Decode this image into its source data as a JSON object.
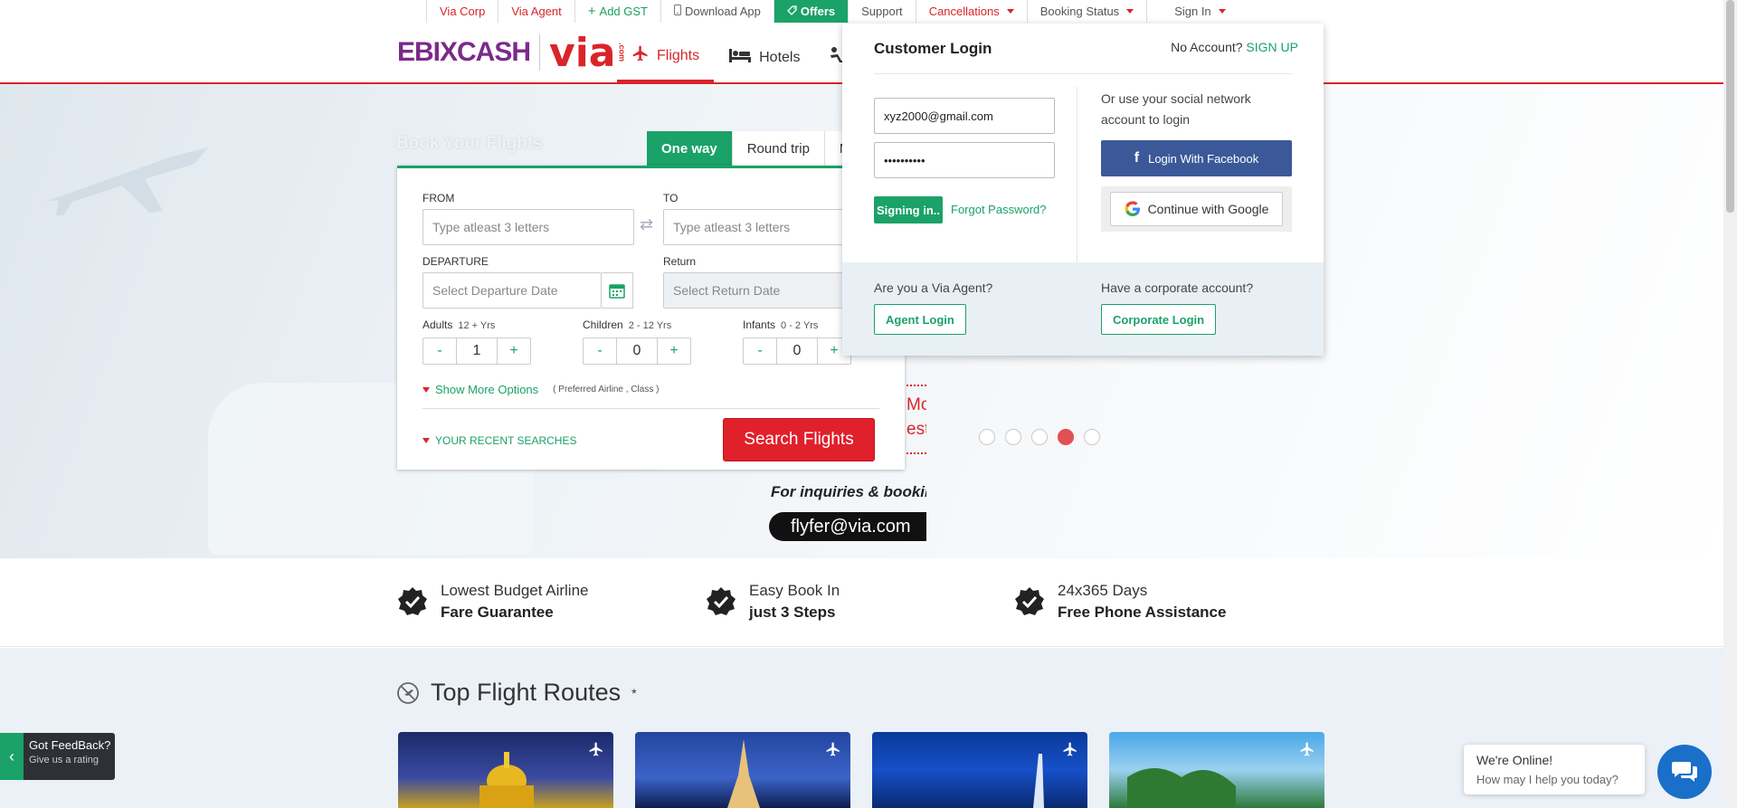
{
  "topbar": {
    "items": [
      {
        "label": "Via Corp",
        "color": "red"
      },
      {
        "label": "Via Agent",
        "color": "red"
      },
      {
        "label": "Add GST",
        "color": "green",
        "icon": "plus-icon"
      },
      {
        "label": "Download App",
        "color": "grey",
        "icon": "mobile-icon"
      },
      {
        "label": "Offers",
        "color": "offers",
        "icon": "tag-icon"
      },
      {
        "label": "Support",
        "color": "grey"
      },
      {
        "label": "Cancellations",
        "color": "red",
        "caret": true
      },
      {
        "label": "Booking Status",
        "color": "grey",
        "caret": true
      },
      {
        "label": "Sign In",
        "color": "grey",
        "caret": true
      }
    ]
  },
  "logo": {
    "ebix": "EBIXCASH",
    "via": "via",
    "com": ".com"
  },
  "nav": {
    "flights": "Flights",
    "hotels": "Hotels"
  },
  "booking": {
    "title": "Book Your Flights",
    "tabs": [
      "One way",
      "Round trip",
      "M"
    ],
    "from_label": "FROM",
    "from_placeholder": "Type atleast 3 letters",
    "to_label": "TO",
    "to_placeholder": "Type atleast 3 letters",
    "departure_label": "DEPARTURE",
    "departure_placeholder": "Select Departure Date",
    "return_label": "Return",
    "return_placeholder": "Select Return Date",
    "adults_label": "Adults",
    "adults_range": "12 + Yrs",
    "adults_value": "1",
    "children_label": "Children",
    "children_range": "2 - 12 Yrs",
    "children_value": "0",
    "infants_label": "Infants",
    "infants_range": "0 - 2 Yrs",
    "infants_value": "0",
    "minus": "-",
    "plus": "+",
    "more_options": "Show More Options",
    "more_options_hint": "( Preferred Airline , Class )",
    "recent": "YOUR RECENT SEARCHES",
    "search_button": "Search Flights"
  },
  "promo": {
    "frag1": "Mo",
    "frag2": "esti",
    "inquiries": "For inquiries & bookin",
    "email": "flyfer@via.com",
    "slide_dots": 5,
    "active_dot": 4
  },
  "features": [
    {
      "line1": "Lowest Budget Airline",
      "line2": "Fare Guarantee"
    },
    {
      "line1": "Easy Book In",
      "line2": "just 3 Steps"
    },
    {
      "line1": "24x365 Days",
      "line2": "Free Phone Assistance"
    }
  ],
  "routes": {
    "title": "Top Flight Routes",
    "mark": "*"
  },
  "login": {
    "title": "Customer Login",
    "no_account": "No Account?",
    "signup": "SIGN UP",
    "email_value": "xyz2000@gmail.com",
    "password_value": "••••••••••",
    "signing_in": "Signing in..",
    "forgot": "Forgot Password?",
    "social_text": "Or use your social network account to login",
    "facebook": "Login With Facebook",
    "google": "Continue with Google",
    "agent_q": "Are you a Via Agent?",
    "agent_btn": "Agent Login",
    "corp_q": "Have a corporate account?",
    "corp_btn": "Corporate Login"
  },
  "feedback": {
    "line1": "Got FeedBack?",
    "line2": "Give us a rating"
  },
  "chat": {
    "line1": "We're Online!",
    "line2": "How may I help you today?"
  },
  "colors": {
    "brand_red": "#d9252a",
    "brand_green": "#1aa269",
    "facebook": "#3b5998",
    "chat_blue": "#1a6fc9"
  }
}
